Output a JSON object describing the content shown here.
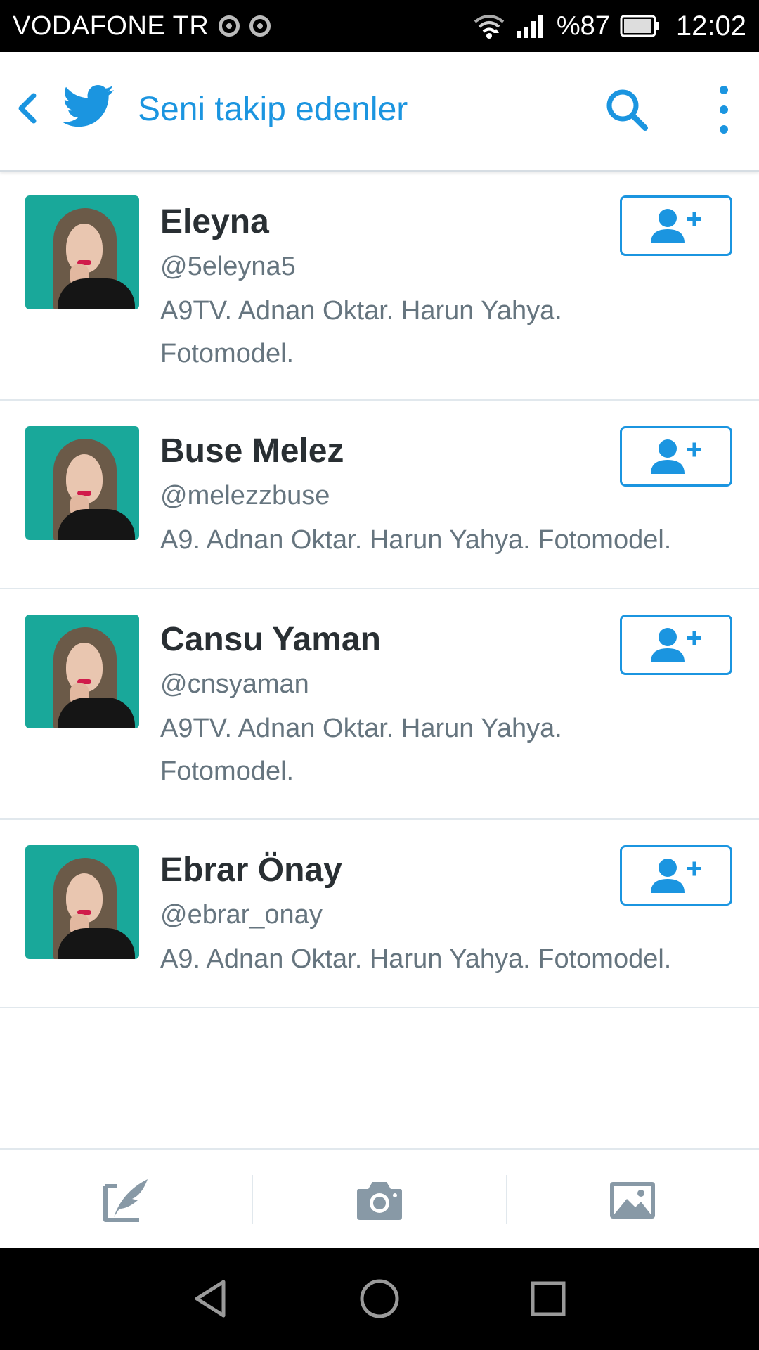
{
  "status_bar": {
    "carrier": "VODAFONE TR",
    "battery": "%87",
    "time": "12:02",
    "icons": [
      "chrome-icon",
      "chrome-icon",
      "wifi-icon",
      "signal-icon",
      "battery-icon"
    ]
  },
  "app_bar": {
    "title": "Seni takip edenler",
    "back_icon": "chevron-left-icon",
    "logo": "twitter-bird-icon",
    "search_icon": "search-icon",
    "more_icon": "more-vertical-icon"
  },
  "followers": [
    {
      "name": "Eleyna",
      "handle": "@5eleyna5",
      "bio_lines": [
        "A9TV. Adnan Oktar. Harun Yahya.",
        "Fotomodel."
      ],
      "action_icon": "follow-user-icon"
    },
    {
      "name": "Buse Melez",
      "handle": "@melezzbuse",
      "bio_lines": [
        "A9. Adnan Oktar. Harun Yahya. Fotomodel."
      ],
      "action_icon": "follow-user-icon"
    },
    {
      "name": "Cansu Yaman",
      "handle": "@cnsyaman",
      "bio_lines": [
        "A9TV. Adnan Oktar. Harun Yahya.",
        "Fotomodel."
      ],
      "action_icon": "follow-user-icon"
    },
    {
      "name": "Ebrar Önay",
      "handle": "@ebrar_onay",
      "bio_lines": [
        "A9. Adnan Oktar. Harun Yahya. Fotomodel."
      ],
      "action_icon": "follow-user-icon"
    }
  ],
  "bottom_bar": {
    "icons": [
      "compose-tweet-icon",
      "camera-icon",
      "image-icon"
    ]
  },
  "nav_bar": {
    "icons": [
      "back-triangle-icon",
      "home-circle-icon",
      "recents-square-icon"
    ]
  },
  "colors": {
    "accent": "#1b95e0",
    "name_text": "#292f33",
    "secondary_text": "#66757f",
    "divider": "#e1e8ed",
    "bottom_icon": "#8899a6"
  }
}
